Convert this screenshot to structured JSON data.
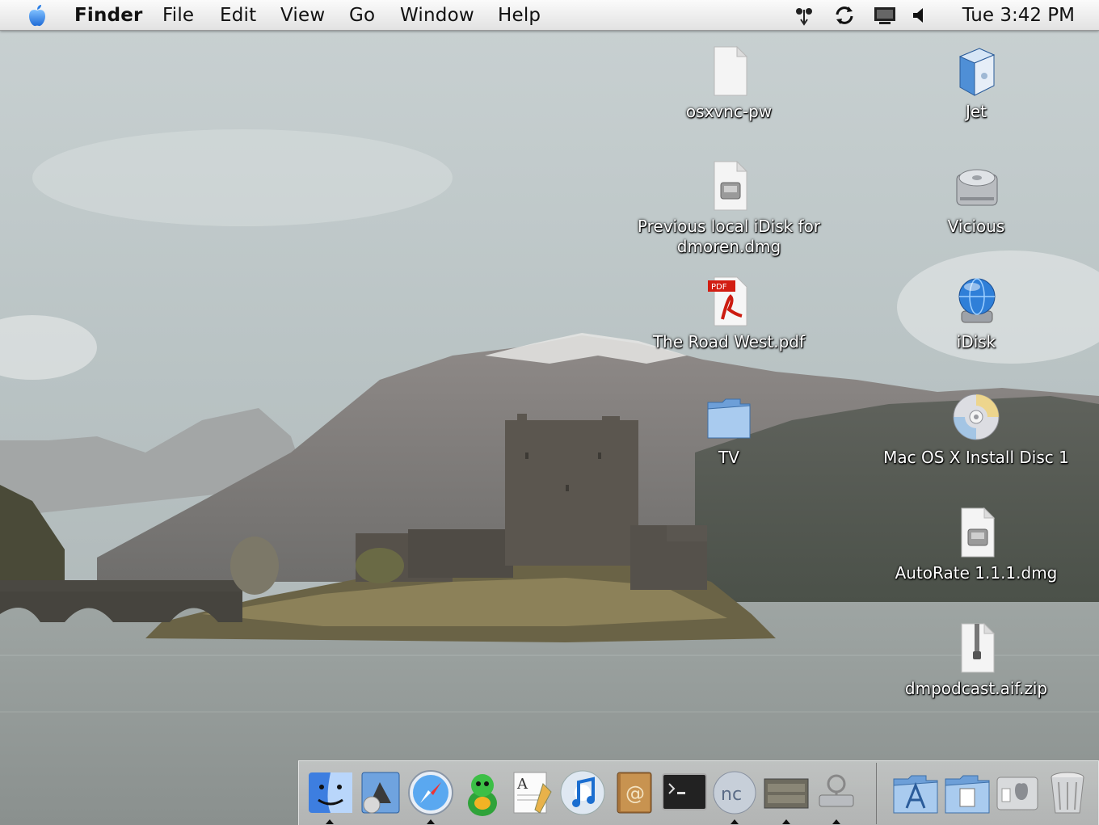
{
  "menubar": {
    "app_name": "Finder",
    "menus": [
      "File",
      "Edit",
      "View",
      "Go",
      "Window",
      "Help"
    ],
    "extras": [
      "script-menu-icon",
      "sync-icon",
      "display-icon",
      "volume-icon"
    ],
    "clock": "Tue 3:42 PM"
  },
  "desktop": {
    "icons": [
      {
        "label": "osxvnc-pw",
        "icon": "document-icon"
      },
      {
        "label": "Jet",
        "icon": "power-mac-g4-icon"
      },
      {
        "label": "Previous local iDisk for dmoren.dmg",
        "icon": "disk-image-icon"
      },
      {
        "label": "Vicious",
        "icon": "hard-drive-icon"
      },
      {
        "label": "The Road West.pdf",
        "icon": "pdf-icon"
      },
      {
        "label": "iDisk",
        "icon": "idisk-icon"
      },
      {
        "label": "TV",
        "icon": "folder-icon"
      },
      {
        "label": "Mac OS X Install Disc 1",
        "icon": "cd-disc-icon"
      },
      {
        "label": "AutoRate 1.1.1.dmg",
        "icon": "disk-image-icon"
      },
      {
        "label": "dmpodcast.aif.zip",
        "icon": "zip-archive-icon"
      }
    ]
  },
  "dock": {
    "apps": [
      {
        "name": "finder-icon",
        "running": true
      },
      {
        "name": "mail-icon",
        "running": false
      },
      {
        "name": "safari-icon",
        "running": true
      },
      {
        "name": "adium-icon",
        "running": false
      },
      {
        "name": "textedit-icon",
        "running": false
      },
      {
        "name": "itunes-icon",
        "running": false
      },
      {
        "name": "address-book-icon",
        "running": false
      },
      {
        "name": "terminal-icon",
        "running": false
      },
      {
        "name": "netnewswire-icon",
        "running": true
      },
      {
        "name": "ticker-app-icon",
        "running": true
      },
      {
        "name": "network-utility-icon",
        "running": true
      }
    ],
    "others": [
      {
        "name": "applications-folder-icon"
      },
      {
        "name": "documents-folder-icon"
      },
      {
        "name": "system-preferences-icon"
      },
      {
        "name": "trash-icon"
      }
    ]
  },
  "colors": {
    "menubar_bg": "#ececec",
    "desktop_label": "#ffffff",
    "folder_blue": "#8fb8e8"
  }
}
